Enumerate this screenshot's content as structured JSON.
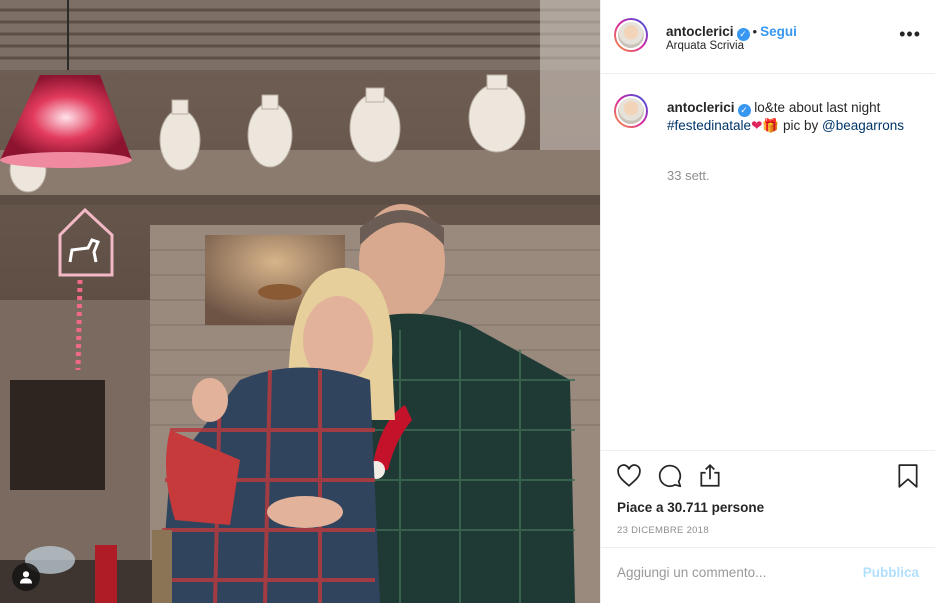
{
  "post": {
    "username": "antoclerici",
    "verified_icon": "verified-badge-icon",
    "follow_label": "Segui",
    "separator": "•",
    "location": "Arquata Scrivia",
    "more_icon": "more-options-icon",
    "more_glyph": "•••"
  },
  "caption": {
    "username": "antoclerici",
    "text_before": "lo&te about last night",
    "hashtag": "#festedinatale",
    "emoji_heart": "❤",
    "emoji_gift": "🎁",
    "text_after": "pic by",
    "mention": "@beagarrons",
    "time_ago": "33 sett."
  },
  "actions": {
    "like_icon": "heart-icon",
    "comment_icon": "comment-icon",
    "share_icon": "share-icon",
    "save_icon": "bookmark-icon",
    "likes_text": "Piace a 30.711 persone",
    "date": "23 DICEMBRE 2018"
  },
  "add_comment": {
    "placeholder": "Aggiungi un commento...",
    "publish_label": "Pubblica"
  },
  "photo": {
    "user_tag_icon": "user-tag-icon"
  },
  "colors": {
    "accent": "#3897f0",
    "link": "#003569",
    "publish_disabled": "#b2dffc",
    "muted": "#8e8e8e"
  }
}
